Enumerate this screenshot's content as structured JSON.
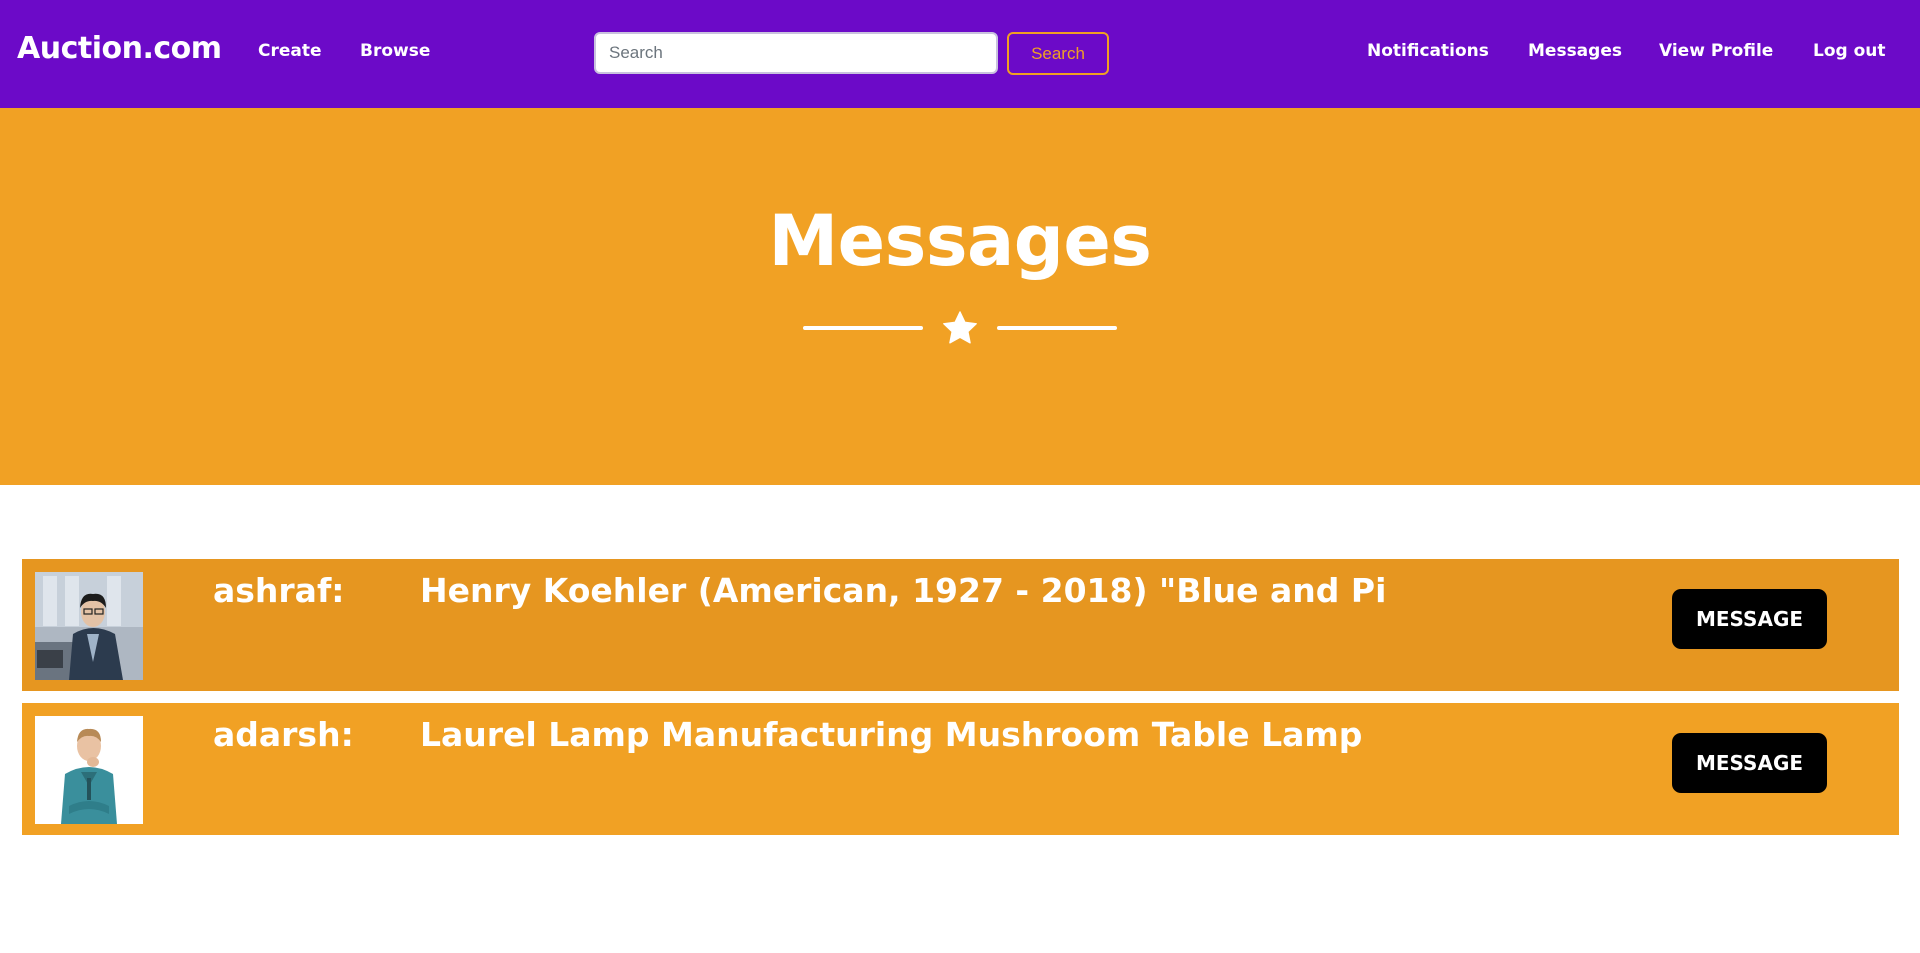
{
  "nav": {
    "brand": "Auction.com",
    "left_links": [
      "Create",
      "Browse"
    ],
    "search_placeholder": "Search",
    "search_value": "",
    "search_button": "Search",
    "right_links": [
      "Notifications",
      "Messages",
      "View Profile",
      "Log out"
    ]
  },
  "hero": {
    "title": "Messages",
    "divider_icon": "star-icon"
  },
  "messages": [
    {
      "username": "ashraf:",
      "title": "Henry Koehler (American, 1927 - 2018) \"Blue and Pi",
      "button": "MESSAGE",
      "avatar": "person-at-desk-photo"
    },
    {
      "username": "adarsh:",
      "title": "Laurel Lamp Manufacturing Mushroom Table Lamp",
      "button": "MESSAGE",
      "avatar": "man-in-teal-shirt-photo"
    }
  ],
  "colors": {
    "navbar": "#6c0ac8",
    "accent": "#f1a124",
    "row_hover": "#e69620",
    "button": "#000000"
  }
}
